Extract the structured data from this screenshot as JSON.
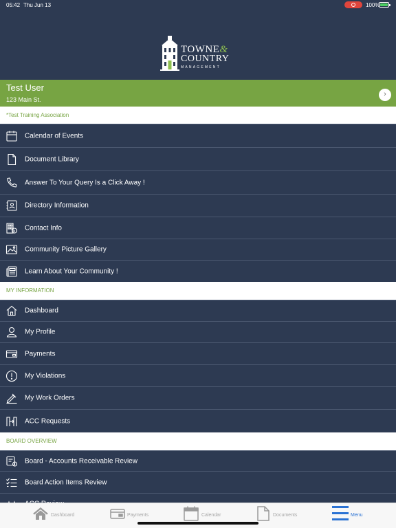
{
  "status": {
    "time": "05:42",
    "date": "Thu Jun 13",
    "battery": "100%"
  },
  "logo": {
    "line1": "TOWNE",
    "amp": "&",
    "line2": "COUNTRY",
    "line3": "MANAGEMENT"
  },
  "user": {
    "name": "Test User",
    "address": "123 Main St."
  },
  "association": "*Test Training Association",
  "community_items": [
    {
      "label": "Calendar of Events",
      "icon": "calendar-icon"
    },
    {
      "label": "Document Library",
      "icon": "document-icon"
    },
    {
      "label": "Answer To Your Query Is a Click Away !",
      "icon": "phone-icon"
    },
    {
      "label": "Directory Information",
      "icon": "contact-card-icon"
    },
    {
      "label": "Contact Info",
      "icon": "building-info-icon"
    },
    {
      "label": "Community Picture Gallery",
      "icon": "picture-icon"
    },
    {
      "label": "Learn About Your Community !",
      "icon": "newspaper-icon"
    }
  ],
  "my_information": {
    "header": "MY INFORMATION",
    "items": [
      {
        "label": "Dashboard",
        "icon": "home-icon"
      },
      {
        "label": "My Profile",
        "icon": "person-icon"
      },
      {
        "label": "Payments",
        "icon": "payment-card-icon"
      },
      {
        "label": "My Violations",
        "icon": "alert-icon"
      },
      {
        "label": "My Work Orders",
        "icon": "work-order-icon"
      },
      {
        "label": "ACC Requests",
        "icon": "acc-icon"
      }
    ]
  },
  "board_overview": {
    "header": "BOARD OVERVIEW",
    "items": [
      {
        "label": "Board - Accounts Receivable Review",
        "icon": "receivable-icon"
      },
      {
        "label": "Board Action Items Review",
        "icon": "checklist-icon"
      },
      {
        "label": "ACC Review",
        "icon": "acc-review-icon"
      }
    ]
  },
  "tabs": [
    {
      "label": "Dashboard",
      "icon": "home-icon"
    },
    {
      "label": "Payments",
      "icon": "payment-card-icon"
    },
    {
      "label": "Calendar",
      "icon": "calendar-icon"
    },
    {
      "label": "Documents",
      "icon": "document-icon"
    },
    {
      "label": "Menu",
      "icon": "menu-icon",
      "active": true
    }
  ],
  "colors": {
    "background": "#2d3a52",
    "accent_green": "#77a443",
    "tab_active": "#2b72d3"
  }
}
